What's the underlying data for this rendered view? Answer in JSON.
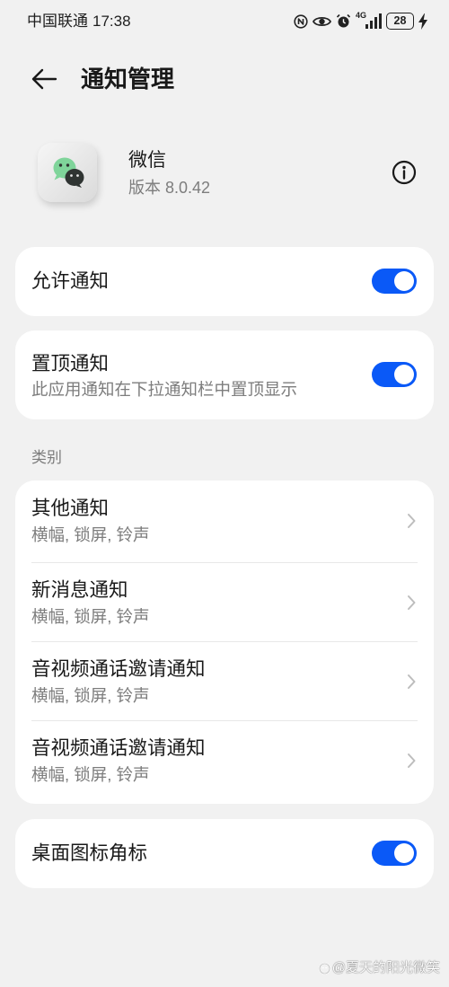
{
  "status_bar": {
    "carrier": "中国联通",
    "time": "17:38",
    "network": "4G",
    "battery": "28"
  },
  "header": {
    "title": "通知管理"
  },
  "app": {
    "name": "微信",
    "version": "版本 8.0.42"
  },
  "allow_notifications": {
    "label": "允许通知",
    "enabled": true
  },
  "pin_notifications": {
    "label": "置顶通知",
    "description": "此应用通知在下拉通知栏中置顶显示",
    "enabled": true
  },
  "categories": {
    "heading": "类别",
    "items": [
      {
        "title": "其他通知",
        "summary": "横幅, 锁屏, 铃声"
      },
      {
        "title": "新消息通知",
        "summary": "横幅, 锁屏, 铃声"
      },
      {
        "title": "音视频通话邀请通知",
        "summary": "横幅, 锁屏, 铃声"
      },
      {
        "title": "音视频通话邀请通知",
        "summary": "横幅, 锁屏, 铃声"
      }
    ]
  },
  "badge": {
    "label": "桌面图标角标",
    "enabled": true
  },
  "watermark": "@夏天的阳光微笑",
  "icons": {
    "back": "arrow-left-icon",
    "info": "info-icon",
    "chevron": "chevron-right-icon",
    "nfc": "nfc-icon",
    "eye": "eye-icon",
    "alarm": "alarm-icon",
    "signal": "signal-icon",
    "battery": "battery-icon",
    "charging": "charging-icon",
    "app": "wechat-app-icon"
  },
  "colors": {
    "background": "#f1f1f1",
    "card": "#ffffff",
    "accent": "#0a59f7",
    "text_primary": "#191919",
    "text_secondary": "#7d7d7d",
    "divider": "#e8e8e8",
    "chevron": "#bdbdbd"
  }
}
